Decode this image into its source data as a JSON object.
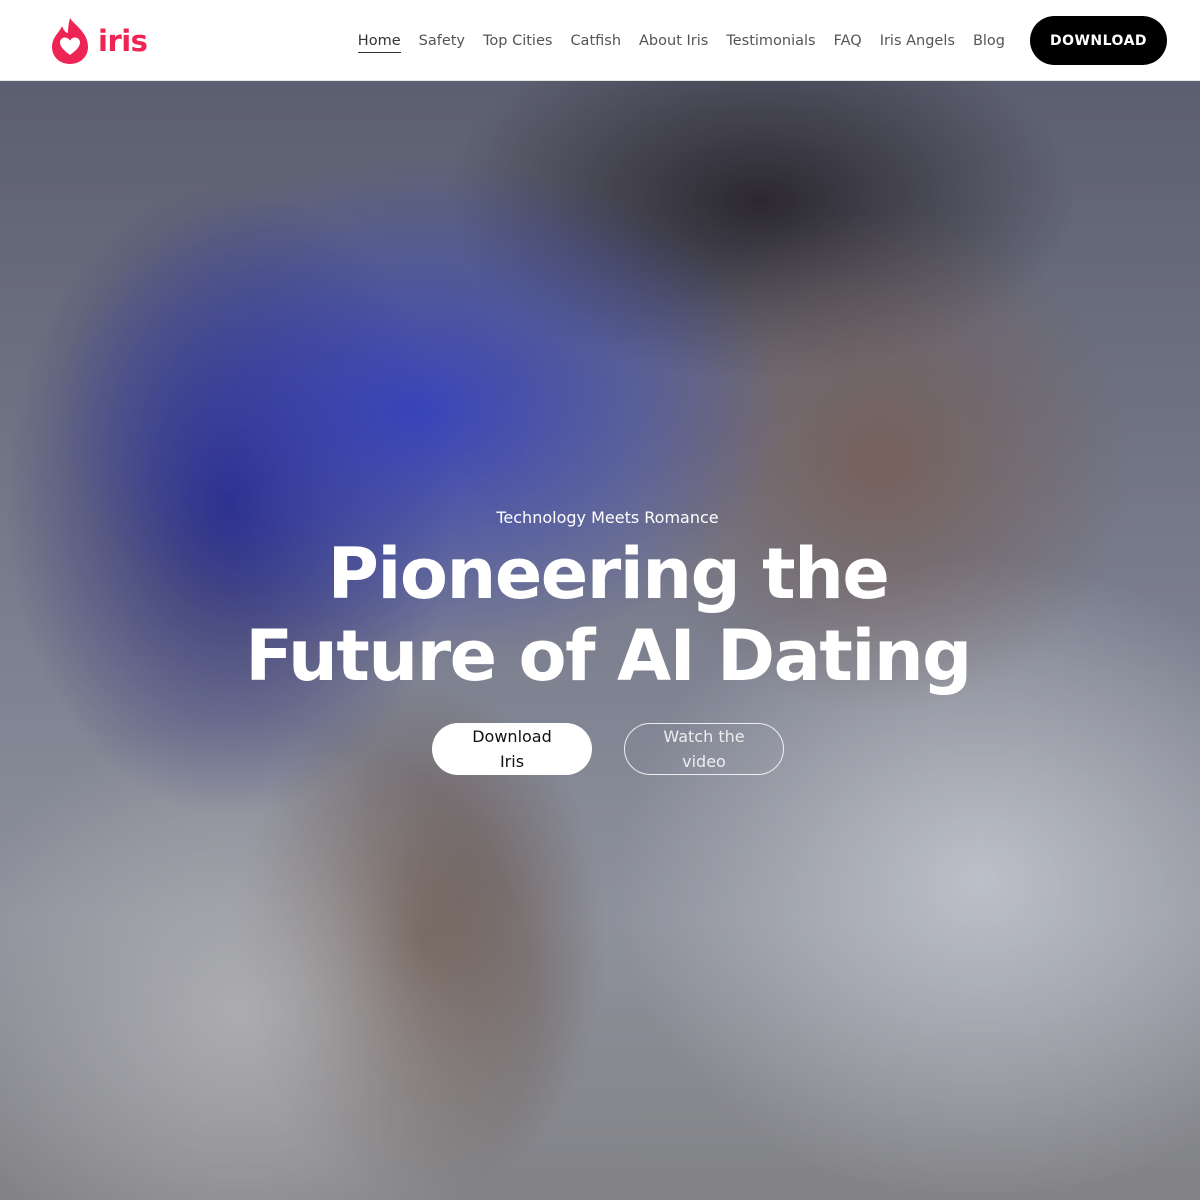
{
  "brand": {
    "name": "iris",
    "logo_icon": "flame-heart-icon",
    "accent_color": "#ee2455"
  },
  "nav": {
    "items": [
      {
        "label": "Home",
        "active": true
      },
      {
        "label": "Safety",
        "active": false
      },
      {
        "label": "Top Cities",
        "active": false
      },
      {
        "label": "Catfish",
        "active": false
      },
      {
        "label": "About Iris",
        "active": false
      },
      {
        "label": "Testimonials",
        "active": false
      },
      {
        "label": "FAQ",
        "active": false
      },
      {
        "label": "Iris Angels",
        "active": false
      },
      {
        "label": "Blog",
        "active": false
      }
    ],
    "download_label": "DOWNLOAD"
  },
  "hero": {
    "background": "hero-photo-couple",
    "tagline": "Technology Meets Romance",
    "headline_line1": "Pioneering the",
    "headline_line2": "Future of AI Dating",
    "primary_cta": "Download Iris",
    "secondary_cta": "Watch the video"
  }
}
